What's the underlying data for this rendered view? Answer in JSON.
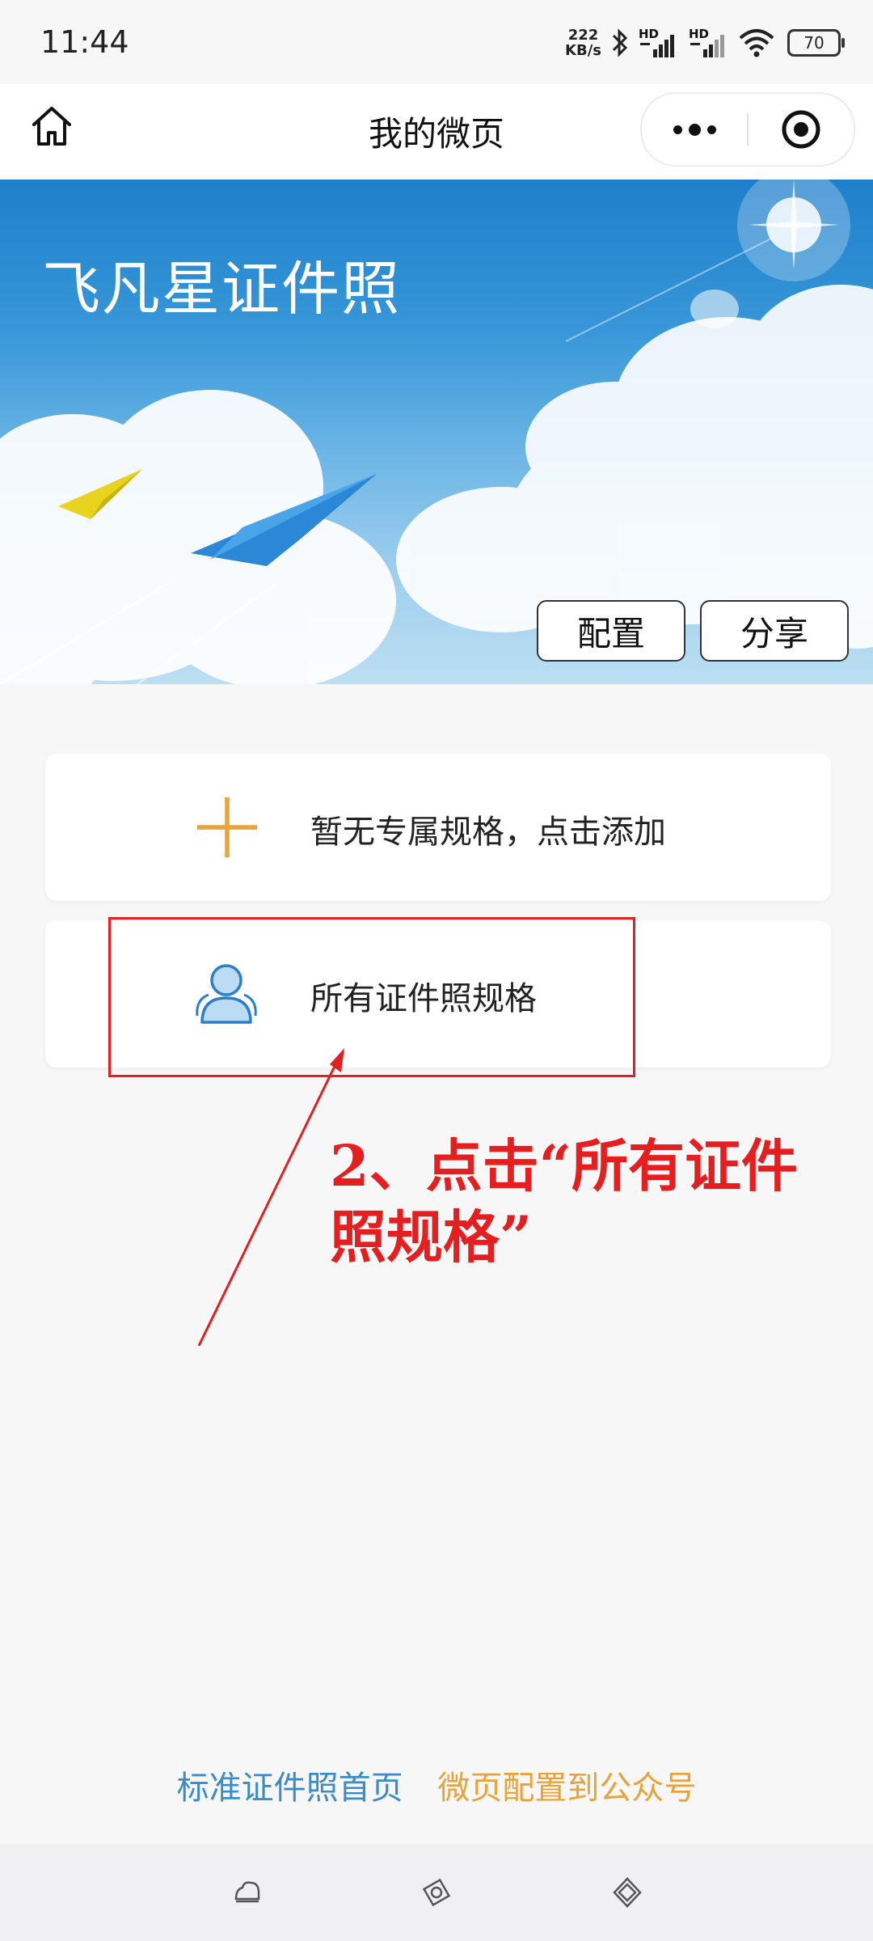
{
  "status_bar": {
    "time": "11:44",
    "net_speed_value": "222",
    "net_speed_unit": "KB/s",
    "signal_1_label": "HD",
    "signal_2_label": "HD",
    "battery": "70"
  },
  "nav": {
    "title": "我的微页"
  },
  "banner": {
    "title": "飞凡星证件照",
    "config_label": "配置",
    "share_label": "分享"
  },
  "cards": [
    {
      "label": "暂无专属规格，点击添加",
      "icon": "plus-icon"
    },
    {
      "label": "所有证件照规格",
      "icon": "person-icon"
    }
  ],
  "annotation": {
    "text": "2、点击“所有证件照规格”",
    "color": "#e51f1f"
  },
  "footer": {
    "home_link": "标准证件照首页",
    "wx_link": "微页配置到公众号"
  },
  "colors": {
    "accent_orange": "#e8a33a",
    "link_blue": "#3a8bc9",
    "annotation_red": "#e51f1f"
  }
}
